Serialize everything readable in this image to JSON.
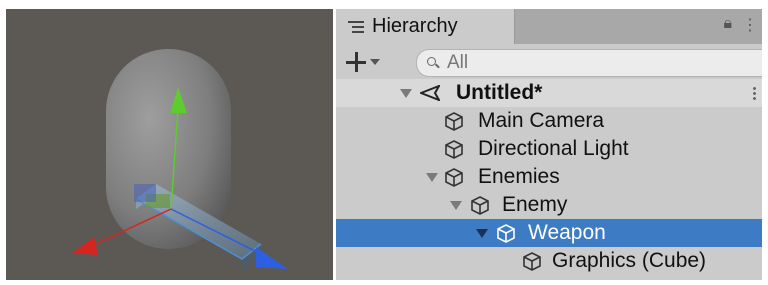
{
  "hierarchy": {
    "tab_label": "Hierarchy",
    "search_placeholder": "All",
    "items": [
      {
        "label": "Untitled*",
        "depth": 0,
        "expanded": true,
        "icon": "unity-scene-icon"
      },
      {
        "label": "Main Camera",
        "depth": 1,
        "expanded": null,
        "icon": "cube-icon"
      },
      {
        "label": "Directional Light",
        "depth": 1,
        "expanded": null,
        "icon": "cube-icon"
      },
      {
        "label": "Enemies",
        "depth": 1,
        "expanded": true,
        "icon": "cube-icon"
      },
      {
        "label": "Enemy",
        "depth": 2,
        "expanded": true,
        "icon": "cube-icon"
      },
      {
        "label": "Weapon",
        "depth": 3,
        "expanded": true,
        "icon": "cube-icon",
        "selected": true
      },
      {
        "label": "Graphics (Cube)",
        "depth": 4,
        "expanded": null,
        "icon": "cube-icon"
      }
    ]
  },
  "colors": {
    "selection": "#3d7bc4",
    "scene_bg": "#5c5954",
    "gizmo_y": "#5ecb2e",
    "gizmo_x": "#d6241e",
    "gizmo_z": "#2d5fe0"
  }
}
